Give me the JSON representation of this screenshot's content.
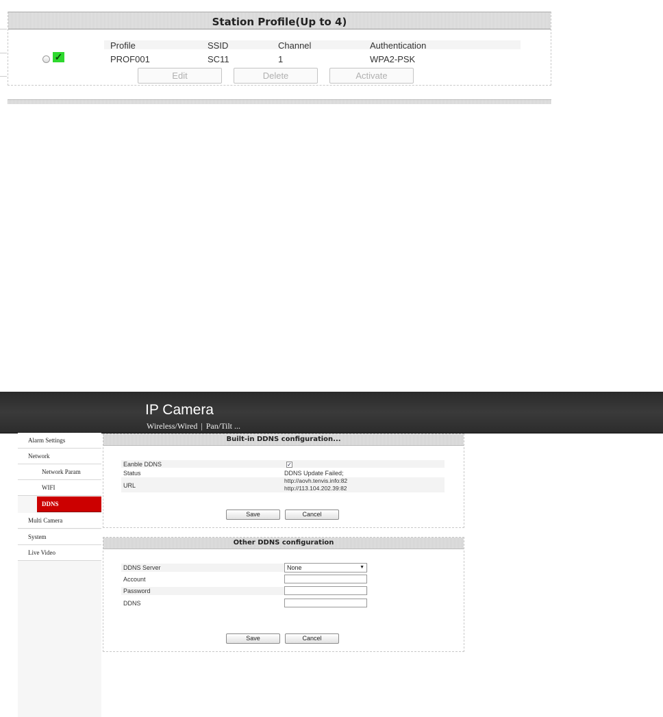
{
  "station_profile": {
    "title": "Station Profile(Up to 4)",
    "columns": [
      "Profile",
      "SSID",
      "Channel",
      "Authentication"
    ],
    "rows": [
      {
        "profile": "PROF001",
        "ssid": "SC11",
        "channel": "1",
        "authentication": "WPA2-PSK",
        "active_icon": "check-icon"
      }
    ],
    "buttons": {
      "edit": "Edit",
      "delete": "Delete",
      "activate": "Activate"
    }
  },
  "app": {
    "title": "IP Camera",
    "nav": [
      "Wireless/Wired",
      "Pan/Tilt ..."
    ],
    "sidebar": [
      {
        "label": "Alarm Settings"
      },
      {
        "label": "Network"
      },
      {
        "label": "Network Param"
      },
      {
        "label": "WIFI"
      },
      {
        "label": "DDNS"
      },
      {
        "label": "Multi Camera"
      },
      {
        "label": "System"
      },
      {
        "label": "Live Video"
      }
    ],
    "active_color": "#cc0000"
  },
  "builtin_ddns": {
    "title": "Built-in DDNS configuration...",
    "enable_label": "Eanble DDNS",
    "enable_checked": true,
    "status_label": "Status",
    "status_value": "DDNS Update Failed;",
    "url_label": "URL",
    "url_values": [
      "http://aovh.tenvis.info:82",
      "http://113.104.202.39:82"
    ],
    "save_label": "Save",
    "cancel_label": "Cancel"
  },
  "other_ddns": {
    "title": "Other DDNS configuration",
    "server_label": "DDNS Server",
    "server_value": "None",
    "account_label": "Account",
    "account_value": "",
    "password_label": "Password",
    "password_value": "",
    "ddns_label": "DDNS",
    "ddns_value": "",
    "save_label": "Save",
    "cancel_label": "Cancel"
  }
}
